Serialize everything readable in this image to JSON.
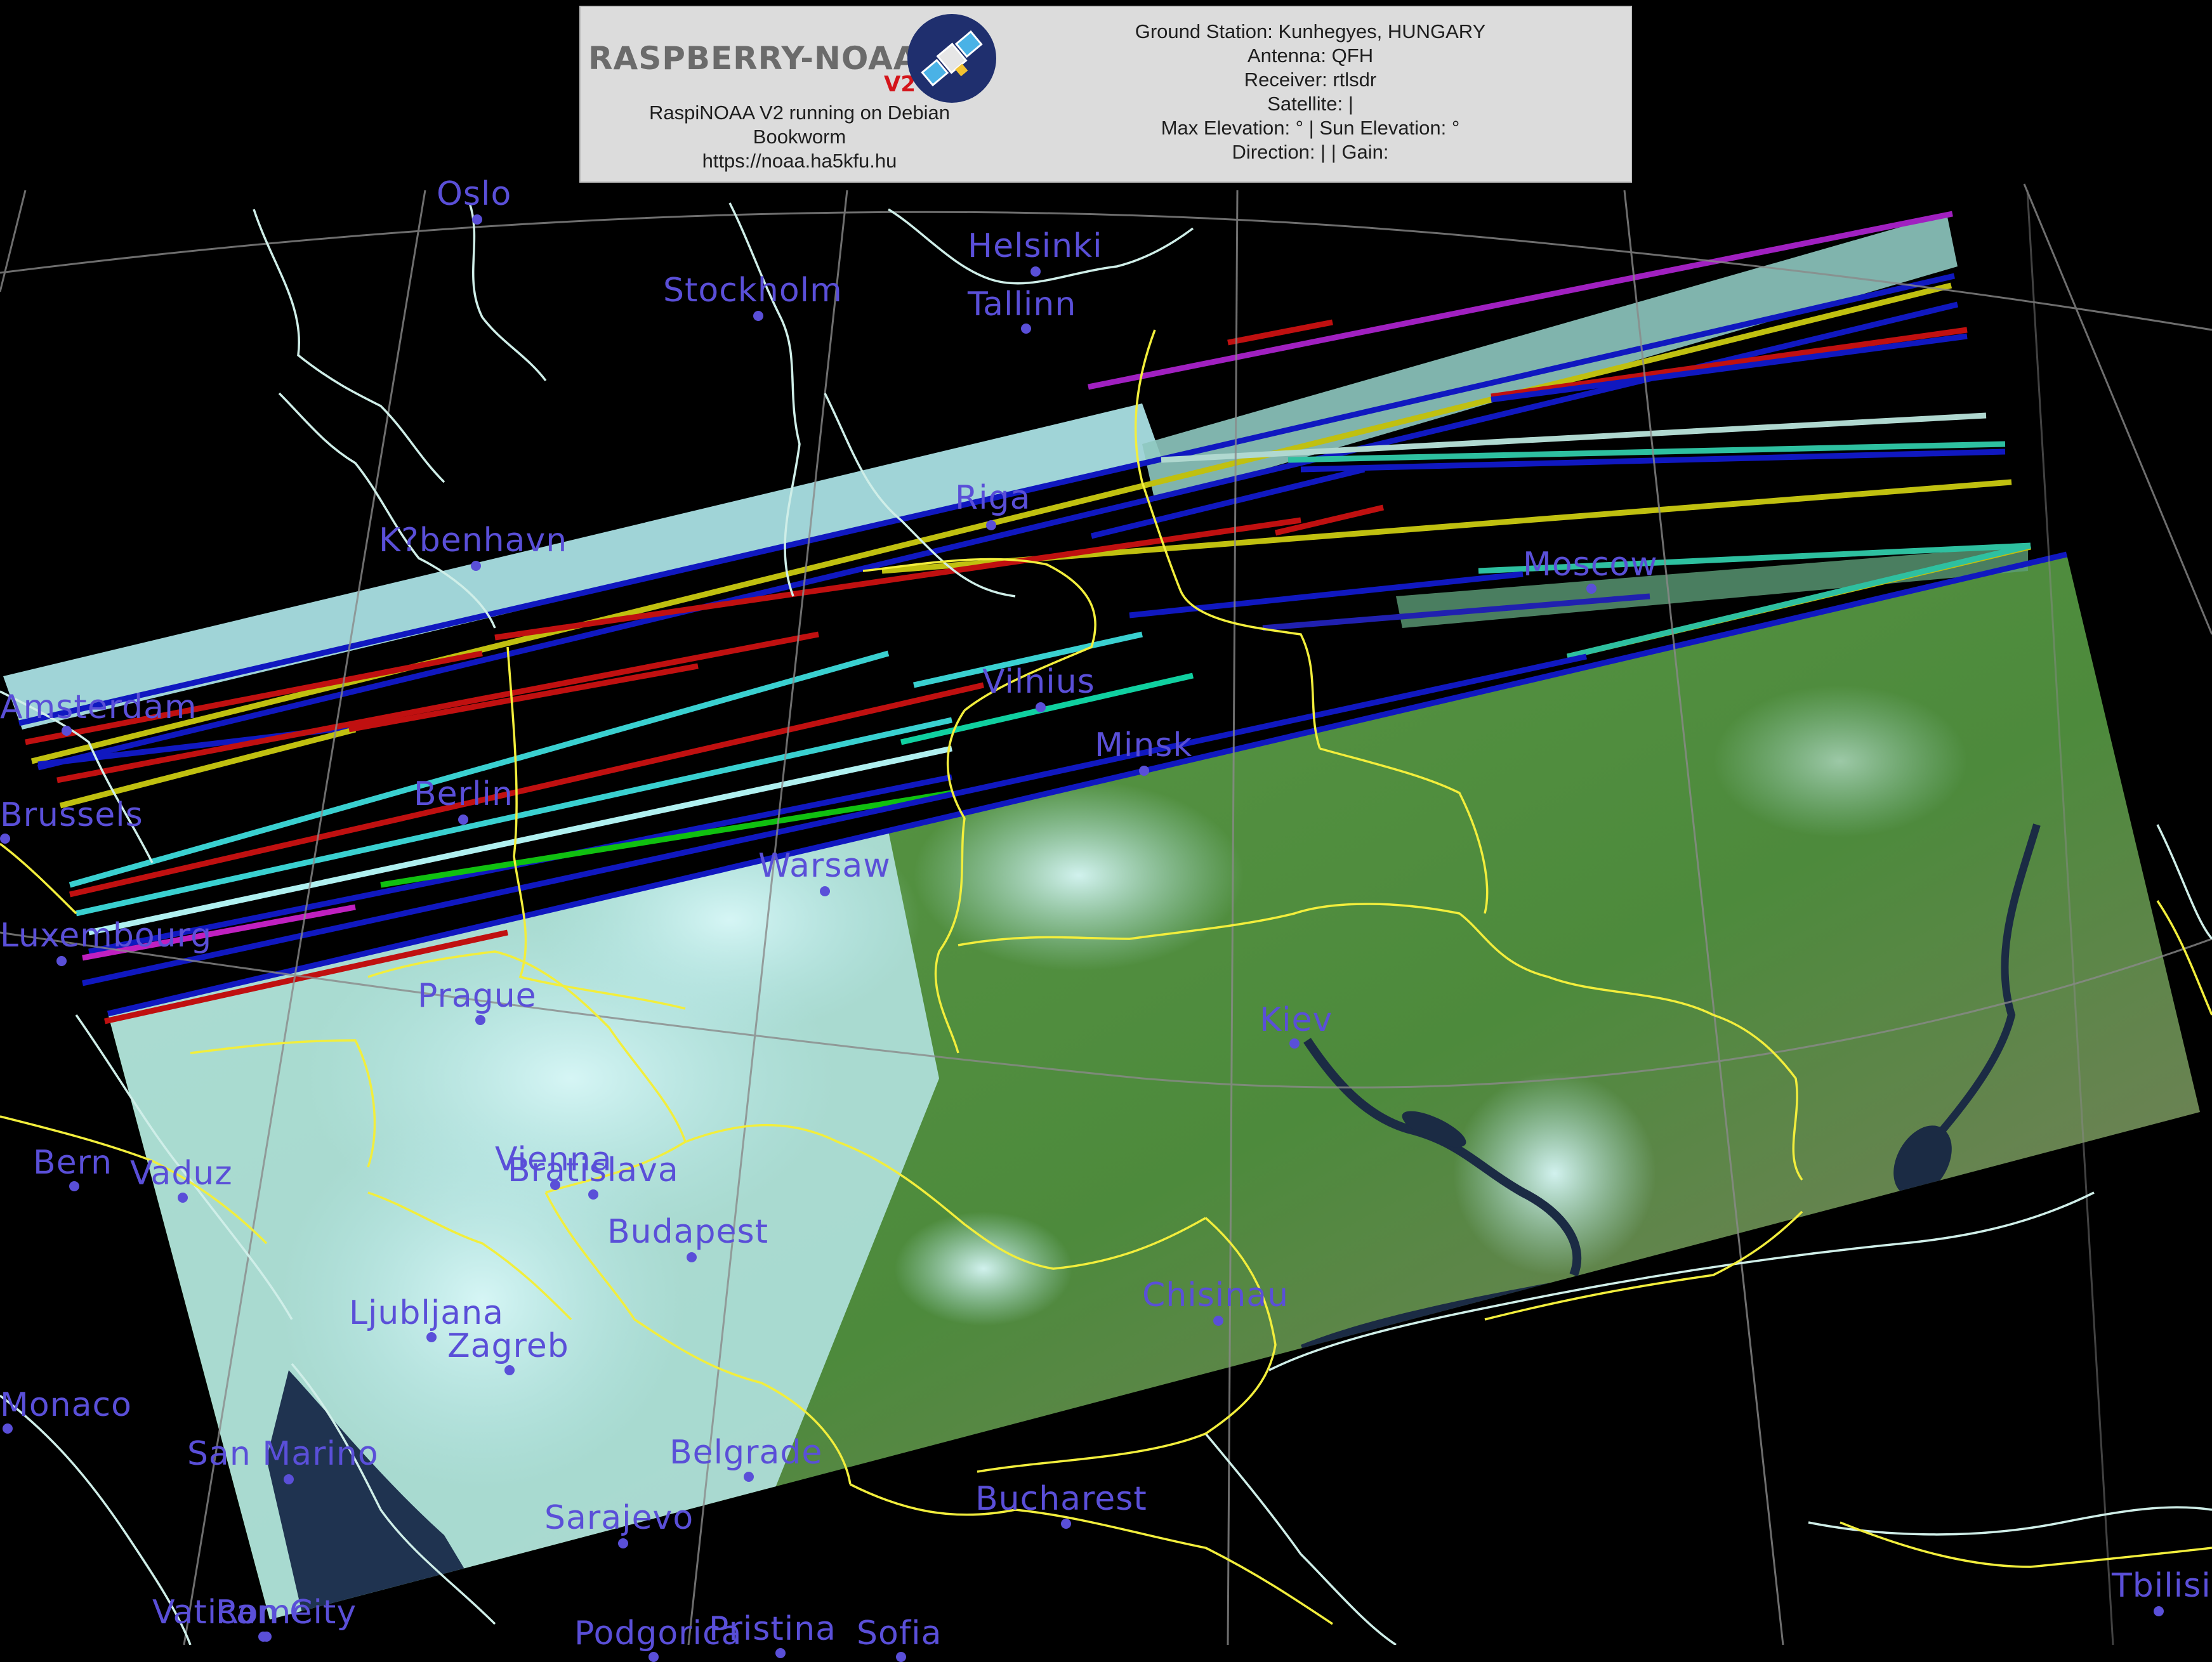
{
  "header": {
    "logo_text": "RASPBERRY-NOAA",
    "logo_version": "V2",
    "left_lines": [
      "RaspiNOAA V2 running on Debian",
      "Bookworm",
      "https://noaa.ha5kfu.hu"
    ],
    "right_lines": [
      "Ground Station: Kunhegyes, HUNGARY",
      "Antenna: QFH",
      "Receiver: rtlsdr",
      "Satellite: |",
      "Max Elevation: ° | Sun Elevation: °",
      "Direction: | | Gain:"
    ]
  },
  "colors": {
    "city_label": "#5a4fd8",
    "borders": "#f2ee3c",
    "coastline": "#cfeee8",
    "graticule": "#bdbdbd",
    "land": "#4f8a3e",
    "cloud": "#c9f0f0"
  },
  "cities": [
    {
      "name": "Oslo"
    },
    {
      "name": "Helsinki"
    },
    {
      "name": "Stockholm"
    },
    {
      "name": "Tallinn"
    },
    {
      "name": "Riga"
    },
    {
      "name": "K?benhavn"
    },
    {
      "name": "Moscow"
    },
    {
      "name": "Amsterdam"
    },
    {
      "name": "Vilnius"
    },
    {
      "name": "Minsk"
    },
    {
      "name": "Berlin"
    },
    {
      "name": "Brussels"
    },
    {
      "name": "Warsaw"
    },
    {
      "name": "Luxembourg"
    },
    {
      "name": "Prague"
    },
    {
      "name": "Kiev"
    },
    {
      "name": "Bern"
    },
    {
      "name": "Vaduz"
    },
    {
      "name": "Vienna"
    },
    {
      "name": "Bratislava"
    },
    {
      "name": "Budapest"
    },
    {
      "name": "Ljubljana"
    },
    {
      "name": "Zagreb"
    },
    {
      "name": "Chisinau"
    },
    {
      "name": "Monaco"
    },
    {
      "name": "San Marino"
    },
    {
      "name": "Belgrade"
    },
    {
      "name": "Bucharest"
    },
    {
      "name": "Sarajevo"
    },
    {
      "name": "Vatican City"
    },
    {
      "name": "Rome"
    },
    {
      "name": "Podgorica"
    },
    {
      "name": "Pristina"
    },
    {
      "name": "Sofia"
    },
    {
      "name": "Tbilisi"
    }
  ]
}
